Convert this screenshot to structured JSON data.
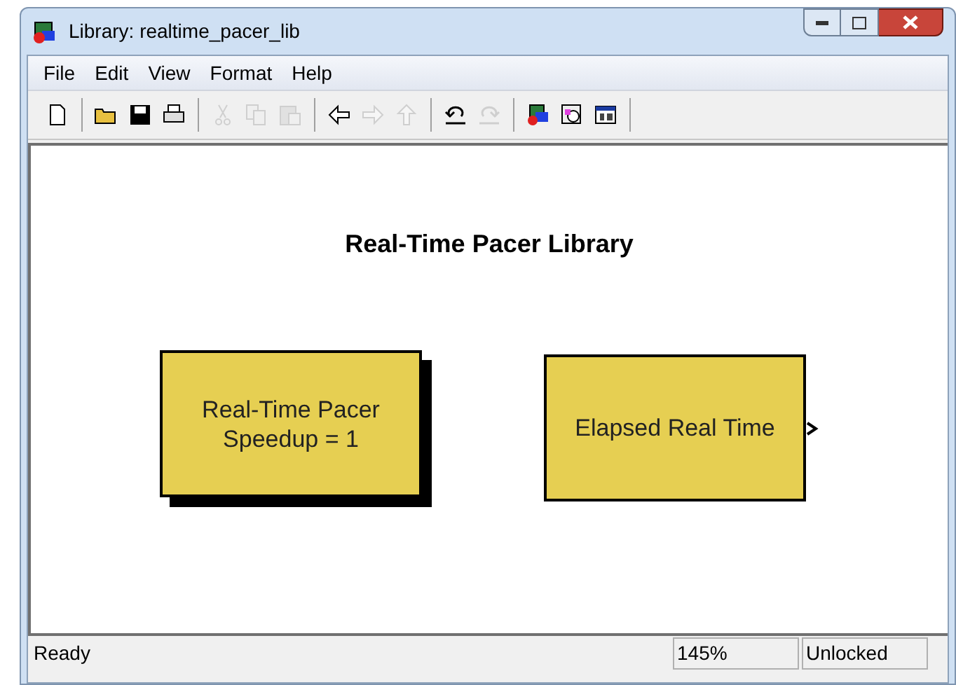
{
  "window": {
    "title": "Library: realtime_pacer_lib"
  },
  "menu": [
    "File",
    "Edit",
    "View",
    "Format",
    "Help"
  ],
  "toolbar": [
    {
      "kind": "new",
      "disabled": false
    },
    {
      "kind": "sep"
    },
    {
      "kind": "open",
      "disabled": false
    },
    {
      "kind": "save",
      "disabled": false
    },
    {
      "kind": "print",
      "disabled": false
    },
    {
      "kind": "sep"
    },
    {
      "kind": "cut",
      "disabled": true
    },
    {
      "kind": "copy",
      "disabled": true
    },
    {
      "kind": "paste",
      "disabled": true
    },
    {
      "kind": "sep"
    },
    {
      "kind": "back",
      "disabled": false
    },
    {
      "kind": "forward",
      "disabled": true
    },
    {
      "kind": "up",
      "disabled": true
    },
    {
      "kind": "sep"
    },
    {
      "kind": "undo",
      "disabled": false
    },
    {
      "kind": "redo",
      "disabled": true
    },
    {
      "kind": "sep"
    },
    {
      "kind": "library",
      "disabled": false
    },
    {
      "kind": "explorer",
      "disabled": false
    },
    {
      "kind": "model",
      "disabled": false
    },
    {
      "kind": "sep"
    }
  ],
  "canvas": {
    "title": "Real-Time Pacer Library",
    "blocks": [
      {
        "lines": [
          "Real-Time Pacer",
          "Speedup = 1"
        ],
        "shadow": true,
        "output_port": false
      },
      {
        "lines": [
          "Elapsed Real Time"
        ],
        "shadow": false,
        "output_port": true
      }
    ]
  },
  "status_bar": {
    "message": "Ready",
    "zoom": "145%",
    "lock": "Unlocked"
  }
}
